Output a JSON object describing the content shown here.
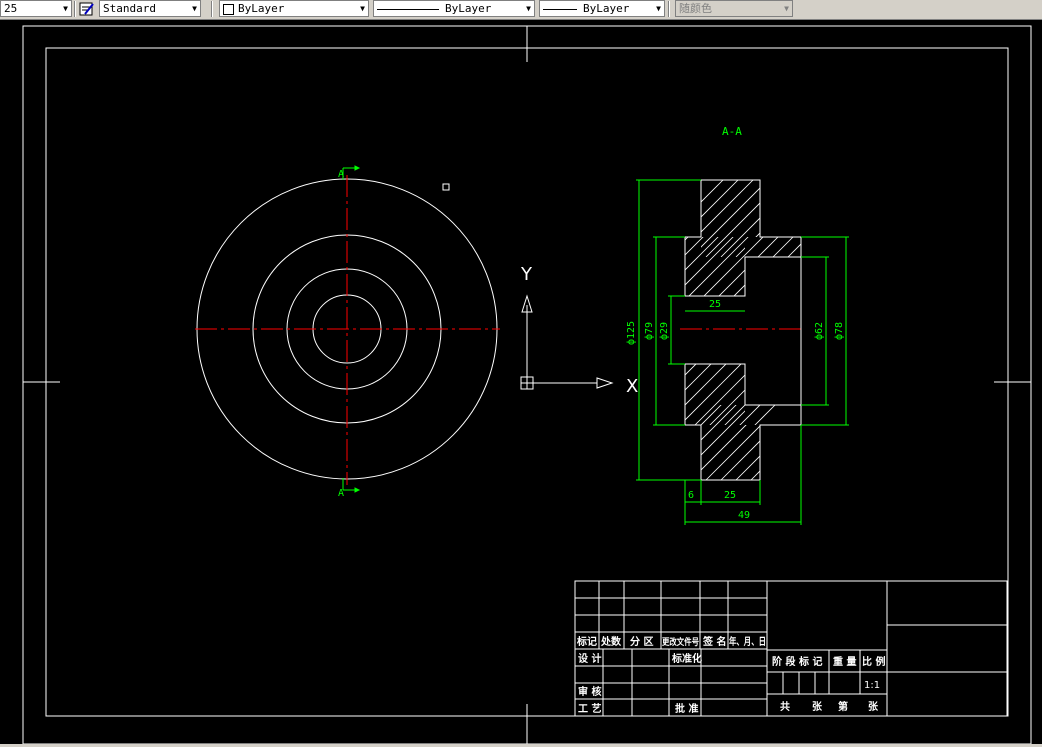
{
  "toolbar": {
    "scale_value": "25",
    "text_style": "Standard",
    "layer_color": "ByLayer",
    "linetype": "ByLayer",
    "lineweight": "ByLayer",
    "plot_style": "随颜色"
  },
  "drawing": {
    "section_label": "A-A",
    "cut_mark_top": "A",
    "cut_mark_bottom": "A",
    "ucs_x": "X",
    "ucs_y": "Y",
    "dims": {
      "d125": "ф125",
      "d79": "ф79",
      "d29": "ф29",
      "d62": "ф62",
      "d78": "ф78",
      "w25_inner": "25",
      "w6": "6",
      "w25_bottom": "25",
      "w49": "49"
    }
  },
  "title_block": {
    "h_biaoji": "标记",
    "h_chushu": "处数",
    "h_fenqu": "分 区",
    "h_genggai": "更改文件号",
    "h_qianming": "签 名",
    "h_date": "年、月、日",
    "sheji": "设 计",
    "biaozhunhua": "标准化",
    "shenhe": "审 核",
    "gongyi": "工 艺",
    "pizhun": "批 准",
    "jieduan": "阶 段 标 记",
    "zhongliang": "重 量",
    "bili": "比 例",
    "scale": "1:1",
    "gong": "共",
    "zhang1": "张",
    "di": "第",
    "zhang2": "张"
  },
  "colors": {
    "background": "#000000",
    "white": "#ffffff",
    "dimension": "#00ff00",
    "centerline": "#ff0000",
    "toolbar": "#d4d0c8"
  }
}
